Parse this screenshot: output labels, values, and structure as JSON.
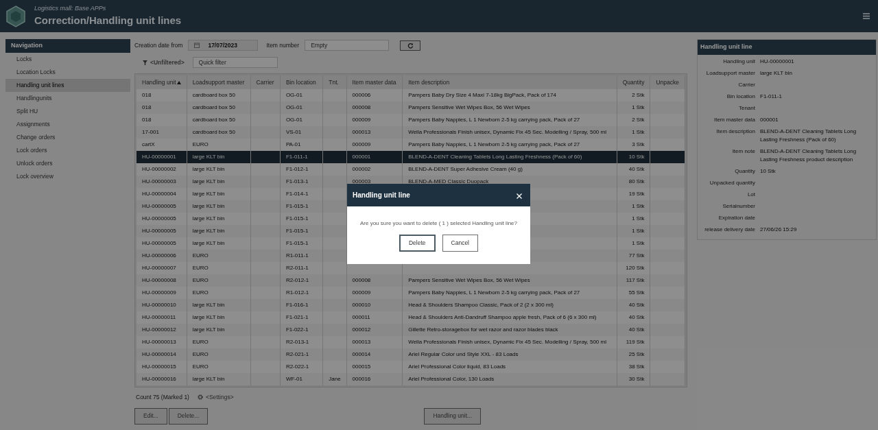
{
  "header": {
    "app_name": "Logistics mall: Base APPs",
    "title": "Correction/Handling unit lines"
  },
  "navigation": {
    "title": "Navigation",
    "items": [
      {
        "label": "Locks",
        "selected": false
      },
      {
        "label": "Location Locks",
        "selected": false
      },
      {
        "label": "Handling unit lines",
        "selected": true
      },
      {
        "label": "Handlingunits",
        "selected": false
      },
      {
        "label": "Split HU",
        "selected": false
      },
      {
        "label": "Assignments",
        "selected": false
      },
      {
        "label": "Change orders",
        "selected": false
      },
      {
        "label": "Lock orders",
        "selected": false
      },
      {
        "label": "Unlock orders",
        "selected": false
      },
      {
        "label": "Lock overview",
        "selected": false
      }
    ]
  },
  "filters": {
    "date_label": "Creation date from",
    "date_value": "17/07/2023",
    "item_label": "Item number",
    "item_placeholder": "Empty",
    "filter_toggle": "<Unfiltered>",
    "quick_filter_placeholder": "Quick filter"
  },
  "table": {
    "columns": [
      {
        "label": "Handling unit",
        "sorted": true
      },
      {
        "label": "Loadsupport master",
        "sorted": false
      },
      {
        "label": "Carrier",
        "sorted": false
      },
      {
        "label": "Bin location",
        "sorted": false
      },
      {
        "label": "Tnt.",
        "sorted": false
      },
      {
        "label": "Item master data",
        "sorted": false
      },
      {
        "label": "Item description",
        "sorted": false
      },
      {
        "label": "Quantity",
        "sorted": false
      },
      {
        "label": "Unpacke",
        "sorted": false
      }
    ],
    "rows": [
      {
        "selected": false,
        "handling_unit": "018",
        "loadsupport_master": "cardboard box 50",
        "bin_location": "OG-01",
        "item_master_data": "000006",
        "item_description": "Pampers Baby Dry Size 4 Maxi 7-18kg BigPack, Pack of 174",
        "quantity": "2 Stk"
      },
      {
        "selected": false,
        "handling_unit": "018",
        "loadsupport_master": "cardboard box 50",
        "bin_location": "OG-01",
        "item_master_data": "000008",
        "item_description": "Pampers Sensitive Wet Wipes Box, 56 Wet Wipes",
        "quantity": "1 Stk"
      },
      {
        "selected": false,
        "handling_unit": "018",
        "loadsupport_master": "cardboard box 50",
        "bin_location": "OG-01",
        "item_master_data": "000009",
        "item_description": "Pampers Baby Nappies, L 1 Newborn 2-5 kg carrying pack, Pack of 27",
        "quantity": "2 Stk"
      },
      {
        "selected": false,
        "handling_unit": "17-001",
        "loadsupport_master": "cardboard box 50",
        "bin_location": "VS-01",
        "item_master_data": "000013",
        "item_description": "Wella Professionals Finish unisex, Dynamic Fix 45 Sec. Modelling / Spray, 500 ml",
        "quantity": "1 Stk"
      },
      {
        "selected": false,
        "handling_unit": "cartX",
        "loadsupport_master": "EURO",
        "bin_location": "PA-01",
        "item_master_data": "000009",
        "item_description": "Pampers Baby Nappies, L 1 Newborn 2-5 kg carrying pack, Pack of 27",
        "quantity": "3 Stk"
      },
      {
        "selected": true,
        "handling_unit": "HU-00000001",
        "loadsupport_master": "large KLT bin",
        "bin_location": "F1-011-1",
        "item_master_data": "000001",
        "item_description": "BLEND-A-DENT Cleaning Tablets Long Lasting Freshness (Pack of 60)",
        "quantity": "10 Stk"
      },
      {
        "selected": false,
        "handling_unit": "HU-00000002",
        "loadsupport_master": "large KLT bin",
        "bin_location": "F1-012-1",
        "item_master_data": "000002",
        "item_description": "BLEND-A-DENT Super Adhesive Cream (40 g)",
        "quantity": "40 Stk"
      },
      {
        "selected": false,
        "handling_unit": "HU-00000003",
        "loadsupport_master": "large KLT bin",
        "bin_location": "F1-013-1",
        "item_master_data": "000003",
        "item_description": "BLEND-A-MED Classic Duopack",
        "quantity": "80 Stk"
      },
      {
        "selected": false,
        "handling_unit": "HU-00000004",
        "loadsupport_master": "large KLT bin",
        "bin_location": "F1-014-1",
        "quantity": "19 Stk"
      },
      {
        "selected": false,
        "handling_unit": "HU-00000005",
        "loadsupport_master": "large KLT bin",
        "bin_location": "F1-015-1",
        "quantity": "1 Stk"
      },
      {
        "selected": false,
        "handling_unit": "HU-00000005",
        "loadsupport_master": "large KLT bin",
        "bin_location": "F1-015-1",
        "quantity": "1 Stk"
      },
      {
        "selected": false,
        "handling_unit": "HU-00000005",
        "loadsupport_master": "large KLT bin",
        "bin_location": "F1-015-1",
        "quantity": "1 Stk"
      },
      {
        "selected": false,
        "handling_unit": "HU-00000005",
        "loadsupport_master": "large KLT bin",
        "bin_location": "F1-015-1",
        "quantity": "1 Stk"
      },
      {
        "selected": false,
        "handling_unit": "HU-00000006",
        "loadsupport_master": "EURO",
        "bin_location": "R1-011-1",
        "quantity": "77 Stk"
      },
      {
        "selected": false,
        "handling_unit": "HU-00000007",
        "loadsupport_master": "EURO",
        "bin_location": "R2-011-1",
        "quantity": "120 Stk"
      },
      {
        "selected": false,
        "handling_unit": "HU-00000008",
        "loadsupport_master": "EURO",
        "bin_location": "R2-012-1",
        "item_master_data": "000008",
        "item_description": "Pampers Sensitive Wet Wipes Box, 56 Wet Wipes",
        "quantity": "117 Stk"
      },
      {
        "selected": false,
        "handling_unit": "HU-00000009",
        "loadsupport_master": "EURO",
        "bin_location": "R1-012-1",
        "item_master_data": "000009",
        "item_description": "Pampers Baby Nappies, L 1 Newborn 2-5 kg carrying pack, Pack of 27",
        "quantity": "55 Stk"
      },
      {
        "selected": false,
        "handling_unit": "HU-00000010",
        "loadsupport_master": "large KLT bin",
        "bin_location": "F1-016-1",
        "item_master_data": "000010",
        "item_description": "Head & Shoulders Shampoo Classic, Pack of 2 (2 x 300 ml)",
        "quantity": "40 Stk"
      },
      {
        "selected": false,
        "handling_unit": "HU-00000011",
        "loadsupport_master": "large KLT bin",
        "bin_location": "F1-021-1",
        "item_master_data": "000011",
        "item_description": "Head & Shoulders Anti-Dandruff Shampoo apple fresh, Pack of 6 (6 x 300 ml)",
        "quantity": "40 Stk"
      },
      {
        "selected": false,
        "handling_unit": "HU-00000012",
        "loadsupport_master": "large KLT bin",
        "bin_location": "F1-022-1",
        "item_master_data": "000012",
        "item_description": "Gillette Retro-storagebox for wet razor and razor blades black",
        "quantity": "40 Stk"
      },
      {
        "selected": false,
        "handling_unit": "HU-00000013",
        "loadsupport_master": "EURO",
        "bin_location": "R2-013-1",
        "item_master_data": "000013",
        "item_description": "Wella Professionals Finish unisex, Dynamic Fix 45 Sec. Modelling / Spray, 500 ml",
        "quantity": "119 Stk"
      },
      {
        "selected": false,
        "handling_unit": "HU-00000014",
        "loadsupport_master": "EURO",
        "bin_location": "R2-021-1",
        "item_master_data": "000014",
        "item_description": "Ariel Regular Color und Style XXL - 83 Loads",
        "quantity": "25 Stk"
      },
      {
        "selected": false,
        "handling_unit": "HU-00000015",
        "loadsupport_master": "EURO",
        "bin_location": "R2-022-1",
        "item_master_data": "000015",
        "item_description": "Ariel Professional Color liquid, 83 Loads",
        "quantity": "38 Stk"
      },
      {
        "selected": false,
        "handling_unit": "HU-00000016",
        "loadsupport_master": "large KLT bin",
        "bin_location": "WF-01",
        "tnt": "Jane",
        "item_master_data": "000016",
        "item_description": "Ariel Professional Color, 130 Loads",
        "quantity": "30 Stk"
      }
    ]
  },
  "footer": {
    "count": "Count 75 (Marked 1)",
    "settings": "<Settings>",
    "buttons": [
      {
        "label": "Edit..."
      },
      {
        "label": "Delete..."
      },
      {
        "label": "Handling unit..."
      }
    ]
  },
  "detail": {
    "title": "Handling unit line",
    "fields": [
      {
        "label": "Handling unit",
        "value": "HU-00000001"
      },
      {
        "label": "Loadsupport master",
        "value": "large KLT bin"
      },
      {
        "label": "Carrier"
      },
      {
        "label": "Bin location",
        "value": "F1-011-1"
      },
      {
        "label": "Tenant"
      },
      {
        "label": "Item master data",
        "value": "000001"
      },
      {
        "label": "Item description",
        "value": "BLEND-A-DENT Cleaning Tablets Long Lasting Freshness (Pack of 60)"
      },
      {
        "label": "Item note",
        "value": "BLEND-A-DENT Cleaning Tablets Long Lasting Freshness product description"
      },
      {
        "label": "Quantity",
        "value": "10 Stk"
      },
      {
        "label": "Unpacked quantity"
      },
      {
        "label": "Lot"
      },
      {
        "label": "Serialnumber"
      },
      {
        "label": "Expiration date"
      },
      {
        "label": "release delivery date",
        "value": "27/06/26 15:29"
      }
    ]
  },
  "dialog": {
    "title": "Handling unit line",
    "message": "Are you sure you want to delete ( 1 ) selected Handling unit line?",
    "buttons": [
      {
        "label": "Delete",
        "selected": true
      },
      {
        "label": "Cancel",
        "selected": false
      }
    ]
  }
}
